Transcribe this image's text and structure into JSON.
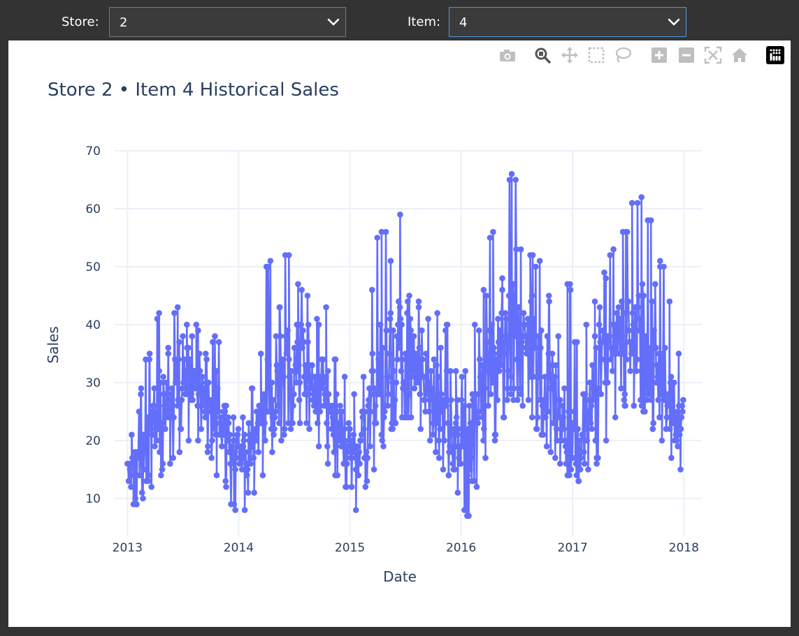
{
  "controls": {
    "store_label": "Store:",
    "store_value": "2",
    "item_label": "Item:",
    "item_value": "4"
  },
  "modebar": {
    "icons": [
      "camera-icon",
      "zoom-icon",
      "pan-icon",
      "box-select-icon",
      "lasso-select-icon",
      "zoom-in-icon",
      "zoom-out-icon",
      "autoscale-icon",
      "reset-axes-icon",
      "plotly-logo-icon"
    ]
  },
  "colors": {
    "series": "#636efa",
    "text": "#2a3f5f",
    "grid": "#ebf0f8",
    "page_bg": "#333333"
  },
  "chart_data": {
    "type": "line",
    "title": "Store 2 • Item 4 Historical Sales",
    "xlabel": "Date",
    "ylabel": "Sales",
    "x_ticks": [
      "2013",
      "2014",
      "2015",
      "2016",
      "2017",
      "2018"
    ],
    "y_ticks": [
      10,
      20,
      30,
      40,
      50,
      60,
      70
    ],
    "xlim": [
      "2012-11-20",
      "2018-03-01"
    ],
    "ylim": [
      3.5,
      70
    ],
    "markers": true,
    "grid": true,
    "series": [
      {
        "name": "",
        "x": [
          "2013-01",
          "2013-02",
          "2013-03",
          "2013-04",
          "2013-05",
          "2013-06",
          "2013-07",
          "2013-08",
          "2013-09",
          "2013-10",
          "2013-11",
          "2013-12",
          "2014-01",
          "2014-02",
          "2014-03",
          "2014-04",
          "2014-05",
          "2014-06",
          "2014-07",
          "2014-08",
          "2014-09",
          "2014-10",
          "2014-11",
          "2014-12",
          "2015-01",
          "2015-02",
          "2015-03",
          "2015-04",
          "2015-05",
          "2015-06",
          "2015-07",
          "2015-08",
          "2015-09",
          "2015-10",
          "2015-11",
          "2015-12",
          "2016-01",
          "2016-02",
          "2016-03",
          "2016-04",
          "2016-05",
          "2016-06",
          "2016-07",
          "2016-08",
          "2016-09",
          "2016-10",
          "2016-11",
          "2016-12",
          "2017-01",
          "2017-02",
          "2017-03",
          "2017-04",
          "2017-05",
          "2017-06",
          "2017-07",
          "2017-08",
          "2017-09",
          "2017-10",
          "2017-11",
          "2017-12"
        ],
        "mean": [
          15,
          17,
          21,
          24,
          27,
          30,
          31,
          30,
          28,
          25,
          22,
          18,
          17,
          19,
          24,
          28,
          31,
          33,
          35,
          33,
          30,
          27,
          23,
          19,
          18,
          21,
          26,
          30,
          33,
          35,
          35,
          33,
          30,
          27,
          24,
          20,
          19,
          23,
          28,
          32,
          36,
          38,
          38,
          36,
          32,
          29,
          25,
          21,
          20,
          24,
          29,
          33,
          37,
          39,
          40,
          38,
          34,
          31,
          27,
          23
        ],
        "min": [
          9,
          10,
          12,
          14,
          16,
          18,
          20,
          20,
          18,
          14,
          12,
          8,
          8,
          11,
          14,
          18,
          20,
          22,
          23,
          22,
          19,
          16,
          14,
          12,
          8,
          12,
          15,
          19,
          22,
          24,
          24,
          22,
          20,
          17,
          14,
          11,
          7,
          12,
          17,
          20,
          24,
          27,
          26,
          24,
          21,
          18,
          16,
          14,
          13,
          15,
          16,
          20,
          24,
          26,
          26,
          25,
          22,
          20,
          17,
          15
        ],
        "max": [
          21,
          29,
          35,
          42,
          36,
          43,
          40,
          40,
          35,
          38,
          26,
          24,
          24,
          29,
          35,
          51,
          43,
          52,
          47,
          45,
          41,
          43,
          34,
          31,
          28,
          31,
          46,
          56,
          51,
          59,
          45,
          44,
          41,
          42,
          40,
          32,
          32,
          40,
          46,
          56,
          48,
          66,
          53,
          52,
          51,
          45,
          38,
          47,
          37,
          40,
          44,
          49,
          53,
          56,
          61,
          62,
          58,
          51,
          44,
          35
        ]
      }
    ]
  }
}
